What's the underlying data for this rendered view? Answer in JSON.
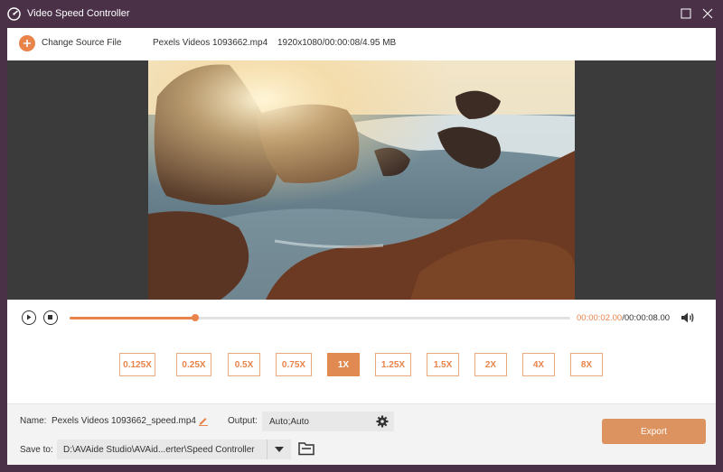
{
  "window": {
    "title": "Video Speed Controller"
  },
  "toolbar": {
    "change_source_label": "Change Source File",
    "file_name": "Pexels Videos 1093662.mp4",
    "file_info": "1920x1080/00:00:08/4.95 MB"
  },
  "playback": {
    "current_time": "00:00:02.00",
    "total_time": "/00:00:08.00",
    "progress": 0.25
  },
  "speeds": [
    {
      "label": "0.125X",
      "active": false
    },
    {
      "label": "0.25X",
      "active": false
    },
    {
      "label": "0.5X",
      "active": false
    },
    {
      "label": "0.75X",
      "active": false
    },
    {
      "label": "1X",
      "active": true
    },
    {
      "label": "1.25X",
      "active": false
    },
    {
      "label": "1.5X",
      "active": false
    },
    {
      "label": "2X",
      "active": false
    },
    {
      "label": "4X",
      "active": false
    },
    {
      "label": "8X",
      "active": false
    }
  ],
  "output": {
    "name_label": "Name:",
    "name_value": "Pexels Videos 1093662_speed.mp4",
    "output_label": "Output:",
    "output_value": "Auto;Auto",
    "save_label": "Save to:",
    "save_path": "D:\\AVAide Studio\\AVAid...erter\\Speed Controller",
    "export_label": "Export"
  },
  "colors": {
    "accent": "#e8844a",
    "titlebar": "#4a3148"
  }
}
